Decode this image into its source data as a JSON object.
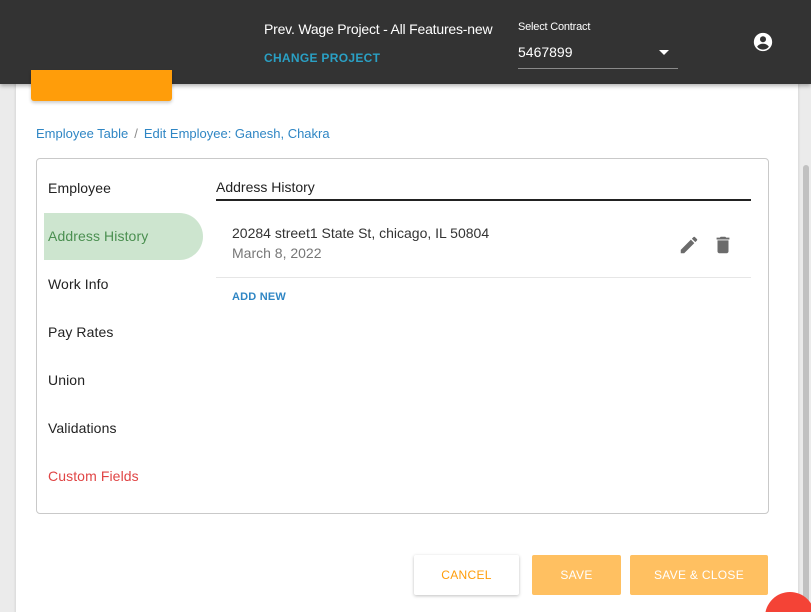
{
  "header": {
    "project_title": "Prev. Wage Project - All Features-new",
    "change_project": "CHANGE PROJECT",
    "contract_label": "Select Contract",
    "contract_value": "5467899"
  },
  "breadcrumb": {
    "parent": "Employee Table",
    "separator": "/",
    "current": "Edit Employee: Ganesh, Chakra"
  },
  "nav": {
    "items": [
      {
        "label": "Employee"
      },
      {
        "label": "Address History"
      },
      {
        "label": "Work Info"
      },
      {
        "label": "Pay Rates"
      },
      {
        "label": "Union"
      },
      {
        "label": "Validations"
      },
      {
        "label": "Custom Fields"
      }
    ],
    "active_index": 1
  },
  "content": {
    "section_title": "Address History",
    "addresses": [
      {
        "address": "20284 street1 State St, chicago, IL 50804",
        "date": "March 8, 2022"
      }
    ],
    "add_new": "ADD NEW"
  },
  "footer": {
    "cancel": "CANCEL",
    "save": "SAVE",
    "save_close": "SAVE & CLOSE"
  },
  "colors": {
    "topbar": "#333333",
    "accent_orange": "#ff9d0a",
    "accent_orange_light": "#ffc061",
    "link_blue": "#2f86c4",
    "active_green_bg": "#cde5cf",
    "active_green_text": "#4a8f50",
    "custom_red": "#e04545"
  },
  "icons": {
    "account": "account-circle-icon",
    "edit": "pencil-icon",
    "delete": "trash-icon",
    "dropdown": "caret-down-icon"
  }
}
